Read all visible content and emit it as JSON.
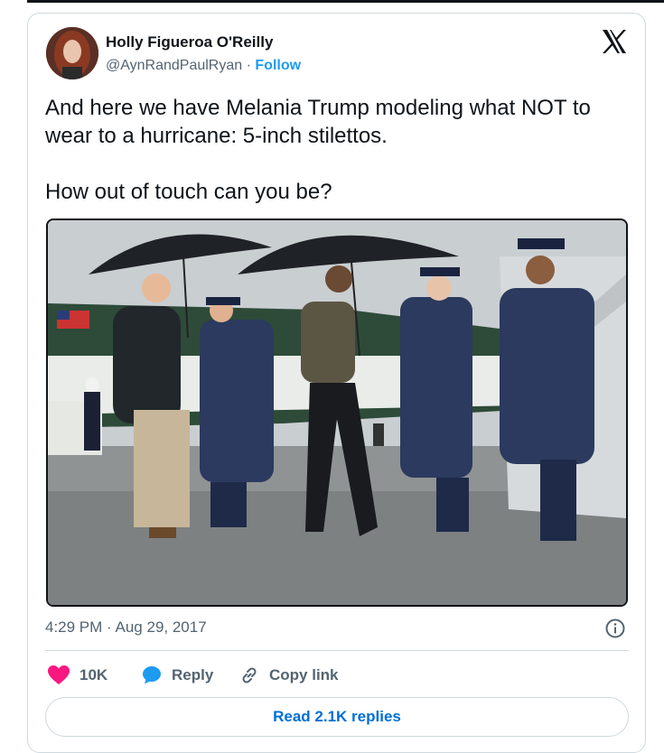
{
  "tweet": {
    "author": {
      "name": "Holly Figueroa O'Reilly",
      "handle": "@AynRandPaulRyan",
      "separator": "·",
      "follow_label": "Follow"
    },
    "text": "And here we have Melania Trump modeling what NOT to wear to a hurricane: 5-inch stilettos.\n\nHow out of touch can you be?",
    "timestamp": {
      "time": "4:29 PM",
      "separator": "·",
      "date": "Aug 29, 2017"
    },
    "actions": {
      "likes": "10K",
      "reply_label": "Reply",
      "copy_link_label": "Copy link"
    },
    "read_replies_label": "Read 2.1K replies"
  },
  "colors": {
    "accent": "#1d9bf0",
    "link": "#006fd6",
    "like": "#f91880",
    "muted": "#536471",
    "border": "#cfd9de"
  },
  "icons": {
    "brand": "x-logo-icon",
    "info": "info-icon",
    "like": "heart-icon",
    "reply": "speech-bubble-icon",
    "copy_link": "link-icon"
  }
}
